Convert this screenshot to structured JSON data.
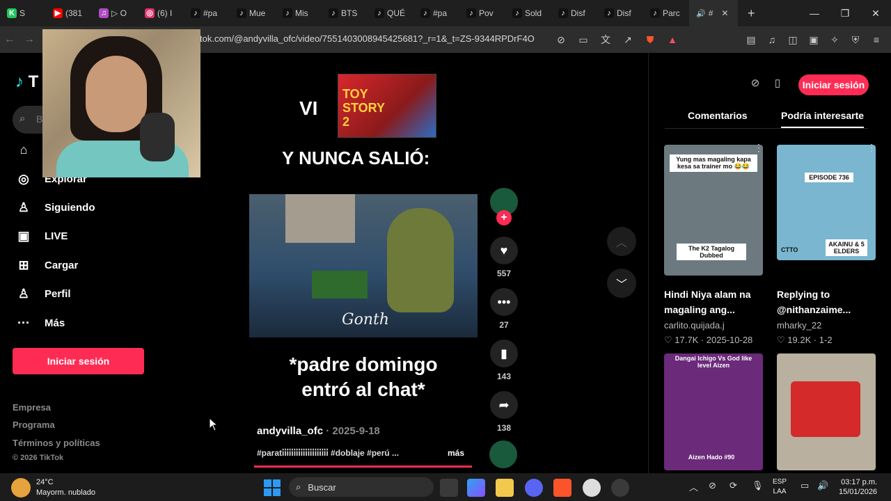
{
  "browser": {
    "tabs": [
      {
        "label": "S",
        "color": "#22c55e",
        "fav": "K"
      },
      {
        "label": "(381",
        "color": "#ff0000",
        "fav": "▶"
      },
      {
        "label": "▷ O",
        "color": "#b04bc4",
        "fav": "♫"
      },
      {
        "label": "(6) I",
        "color": "#e1306c",
        "fav": "◎"
      },
      {
        "label": "#pa",
        "color": "#111",
        "fav": "♪"
      },
      {
        "label": "Mue",
        "color": "#111",
        "fav": "♪"
      },
      {
        "label": "Mis",
        "color": "#111",
        "fav": "♪"
      },
      {
        "label": "BTS",
        "color": "#111",
        "fav": "♪"
      },
      {
        "label": "QUÉ",
        "color": "#111",
        "fav": "♪"
      },
      {
        "label": "#pa",
        "color": "#111",
        "fav": "♪"
      },
      {
        "label": "Pov",
        "color": "#111",
        "fav": "♪"
      },
      {
        "label": "Sold",
        "color": "#111",
        "fav": "♪"
      },
      {
        "label": "Disf",
        "color": "#111",
        "fav": "♪"
      },
      {
        "label": "Disf",
        "color": "#111",
        "fav": "♪"
      },
      {
        "label": "Parc",
        "color": "#111",
        "fav": "♪"
      }
    ],
    "active_tab": {
      "label": "#",
      "audio": "🔊",
      "close": "✕"
    },
    "new_tab": "+",
    "url": "tok.com/@andyvilla_ofc/video/7551403008945425681?_r=1&_t=ZS-9344RPDrF4O"
  },
  "sidebar": {
    "logo": "T",
    "search_placeholder": "B",
    "items": [
      {
        "icon": "⌂",
        "label": ""
      },
      {
        "icon": "◎",
        "label": "Explorar"
      },
      {
        "icon": "♙",
        "label": "Siguiendo"
      },
      {
        "icon": "▣",
        "label": "LIVE"
      },
      {
        "icon": "⊞",
        "label": "Cargar"
      },
      {
        "icon": "♙",
        "label": "Perfil"
      },
      {
        "icon": "···",
        "label": "Más"
      }
    ],
    "login": "Iniciar sesión",
    "footer": [
      "Empresa",
      "Programa",
      "Términos y políticas",
      "© 2026 TikTok"
    ]
  },
  "video": {
    "vi_text": "VI",
    "poster_text": "TOY STORY 2",
    "headline": "Y NUNCA SALIÓ:",
    "clip_signature": "Gonth",
    "caption_line1": "*padre domingo",
    "caption_line2": "entró al chat*",
    "author": "andyvilla_ofc",
    "date": "· 2025-9-18",
    "tags": "#parati̇i̇i̇i̇i̇i̇i̇i̇i̇i̇i̇i̇i̇i̇i̇i̇i̇i̇i̇i̇ #doblaje #perú ...",
    "more": "más",
    "likes": "557",
    "comments": "27",
    "saves": "143",
    "shares": "138",
    "progress": 0.99
  },
  "right_panel": {
    "login": "Iniciar sesión",
    "tab_comments": "Comentarios",
    "tab_interest": "Podría interesarte",
    "cards": [
      {
        "overlay_top": "Yung mas magaling kapa kesa sa trainer mo 😂😂",
        "overlay_bottom": "The K2 Tagalog Dubbed",
        "title": "Hindi Niya alam na magaling ang...",
        "user": "carlito.quijada.j",
        "stats": "♡ 17.7K · 2025-10-28",
        "bg": "#6c7a80"
      },
      {
        "overlay_top": "EPISODE 736",
        "overlay_bottom": "AKAINU & 5 ELDERS",
        "tag": "CTTO",
        "title": "Replying to @nithanzaime...",
        "user": "mharky_22",
        "stats": "♡ 19.2K · 1-2",
        "bg": "#7ab6cf"
      },
      {
        "overlay_top": "Dangai Ichigo Vs God like level Aizen",
        "overlay_bottom": "Aizen Hado #90",
        "bg": "#6b2a7a"
      },
      {
        "bg": "#b9b09f"
      }
    ]
  },
  "taskbar": {
    "temp": "24°C",
    "weather": "Mayorm. nublado",
    "search": "Buscar",
    "lang1": "ESP",
    "lang2": "LAA",
    "time": "03:17 p.m.",
    "date": "15/01/2026"
  }
}
